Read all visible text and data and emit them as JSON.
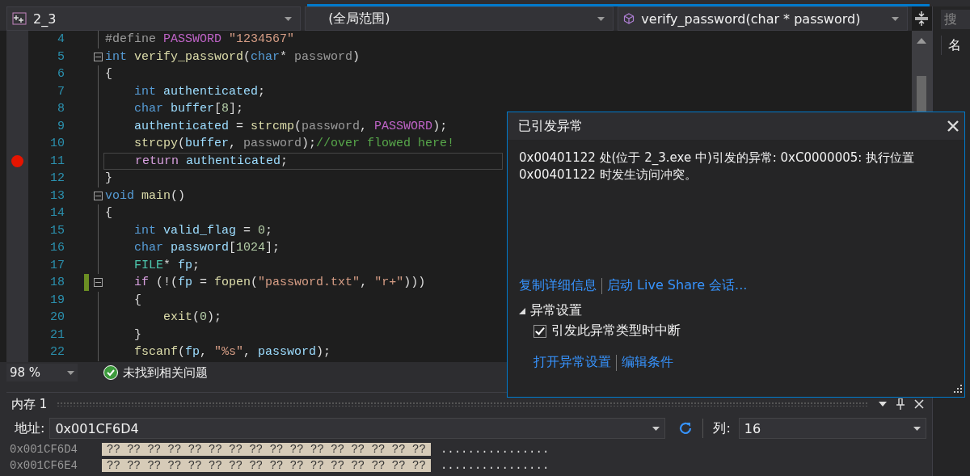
{
  "nav_bar": {
    "project": "2_3",
    "scope": "(全局范围)",
    "member": "verify_password(char * password)"
  },
  "editor": {
    "lines": [
      {
        "number": "4",
        "breakpoint": false,
        "fold": false,
        "changed": false,
        "current": false,
        "tokens": [
          {
            "kind": "preproc",
            "text": "#define "
          },
          {
            "kind": "macro",
            "text": "PASSWORD "
          },
          {
            "kind": "string",
            "text": "\"1234567\""
          }
        ]
      },
      {
        "number": "5",
        "breakpoint": false,
        "fold": true,
        "changed": false,
        "current": false,
        "tokens": [
          {
            "kind": "keyword",
            "text": "int "
          },
          {
            "kind": "func",
            "text": "verify_password"
          },
          {
            "kind": "plain",
            "text": "("
          },
          {
            "kind": "keyword",
            "text": "char"
          },
          {
            "kind": "plain",
            "text": "* "
          },
          {
            "kind": "param",
            "text": "password"
          },
          {
            "kind": "plain",
            "text": ")"
          }
        ]
      },
      {
        "number": "6",
        "breakpoint": false,
        "fold": false,
        "changed": false,
        "current": false,
        "tokens": [
          {
            "kind": "plain",
            "text": "{"
          }
        ]
      },
      {
        "number": "7",
        "breakpoint": false,
        "fold": false,
        "changed": false,
        "current": false,
        "tokens": [
          {
            "kind": "keyword",
            "text": "    int "
          },
          {
            "kind": "var",
            "text": "authenticated"
          },
          {
            "kind": "plain",
            "text": ";"
          }
        ]
      },
      {
        "number": "8",
        "breakpoint": false,
        "fold": false,
        "changed": false,
        "current": false,
        "tokens": [
          {
            "kind": "keyword",
            "text": "    char "
          },
          {
            "kind": "var",
            "text": "buffer"
          },
          {
            "kind": "plain",
            "text": "["
          },
          {
            "kind": "number",
            "text": "8"
          },
          {
            "kind": "plain",
            "text": "];"
          }
        ]
      },
      {
        "number": "9",
        "breakpoint": false,
        "fold": false,
        "changed": false,
        "current": false,
        "tokens": [
          {
            "kind": "var",
            "text": "    authenticated"
          },
          {
            "kind": "plain",
            "text": " = "
          },
          {
            "kind": "func",
            "text": "strcmp"
          },
          {
            "kind": "plain",
            "text": "("
          },
          {
            "kind": "param",
            "text": "password"
          },
          {
            "kind": "plain",
            "text": ", "
          },
          {
            "kind": "macro",
            "text": "PASSWORD"
          },
          {
            "kind": "plain",
            "text": ");"
          }
        ]
      },
      {
        "number": "10",
        "breakpoint": false,
        "fold": false,
        "changed": false,
        "current": false,
        "tokens": [
          {
            "kind": "func",
            "text": "    strcpy"
          },
          {
            "kind": "plain",
            "text": "("
          },
          {
            "kind": "var",
            "text": "buffer"
          },
          {
            "kind": "plain",
            "text": ", "
          },
          {
            "kind": "param",
            "text": "password"
          },
          {
            "kind": "plain",
            "text": ");"
          },
          {
            "kind": "comment",
            "text": "//over flowed here!"
          }
        ]
      },
      {
        "number": "11",
        "breakpoint": true,
        "fold": false,
        "changed": false,
        "current": true,
        "tokens": [
          {
            "kind": "control",
            "text": "    return "
          },
          {
            "kind": "var",
            "text": "authenticated"
          },
          {
            "kind": "plain",
            "text": ";"
          }
        ]
      },
      {
        "number": "12",
        "breakpoint": false,
        "fold": false,
        "changed": false,
        "current": false,
        "tokens": [
          {
            "kind": "plain",
            "text": "}"
          }
        ]
      },
      {
        "number": "13",
        "breakpoint": false,
        "fold": true,
        "changed": false,
        "current": false,
        "tokens": [
          {
            "kind": "keyword",
            "text": "void "
          },
          {
            "kind": "func",
            "text": "main"
          },
          {
            "kind": "plain",
            "text": "()"
          }
        ]
      },
      {
        "number": "14",
        "breakpoint": false,
        "fold": false,
        "changed": false,
        "current": false,
        "tokens": [
          {
            "kind": "plain",
            "text": "{"
          }
        ]
      },
      {
        "number": "15",
        "breakpoint": false,
        "fold": false,
        "changed": false,
        "current": false,
        "tokens": [
          {
            "kind": "keyword",
            "text": "    int "
          },
          {
            "kind": "var",
            "text": "valid_flag"
          },
          {
            "kind": "plain",
            "text": " = "
          },
          {
            "kind": "number",
            "text": "0"
          },
          {
            "kind": "plain",
            "text": ";"
          }
        ]
      },
      {
        "number": "16",
        "breakpoint": false,
        "fold": false,
        "changed": false,
        "current": false,
        "tokens": [
          {
            "kind": "keyword",
            "text": "    char "
          },
          {
            "kind": "var",
            "text": "password"
          },
          {
            "kind": "plain",
            "text": "["
          },
          {
            "kind": "number",
            "text": "1024"
          },
          {
            "kind": "plain",
            "text": "];"
          }
        ]
      },
      {
        "number": "17",
        "breakpoint": false,
        "fold": false,
        "changed": false,
        "current": false,
        "tokens": [
          {
            "kind": "type",
            "text": "    FILE"
          },
          {
            "kind": "plain",
            "text": "* "
          },
          {
            "kind": "var",
            "text": "fp"
          },
          {
            "kind": "plain",
            "text": ";"
          }
        ]
      },
      {
        "number": "18",
        "breakpoint": false,
        "fold": true,
        "changed": true,
        "current": false,
        "tokens": [
          {
            "kind": "control",
            "text": "    if"
          },
          {
            "kind": "plain",
            "text": " (!("
          },
          {
            "kind": "var",
            "text": "fp"
          },
          {
            "kind": "plain",
            "text": " = "
          },
          {
            "kind": "func",
            "text": "fopen"
          },
          {
            "kind": "plain",
            "text": "("
          },
          {
            "kind": "string",
            "text": "\"password.txt\""
          },
          {
            "kind": "plain",
            "text": ", "
          },
          {
            "kind": "string",
            "text": "\"r+\""
          },
          {
            "kind": "plain",
            "text": ")))"
          }
        ]
      },
      {
        "number": "19",
        "breakpoint": false,
        "fold": false,
        "changed": false,
        "current": false,
        "tokens": [
          {
            "kind": "plain",
            "text": "    {"
          }
        ]
      },
      {
        "number": "20",
        "breakpoint": false,
        "fold": false,
        "changed": false,
        "current": false,
        "tokens": [
          {
            "kind": "func",
            "text": "        exit"
          },
          {
            "kind": "plain",
            "text": "("
          },
          {
            "kind": "number",
            "text": "0"
          },
          {
            "kind": "plain",
            "text": ");"
          }
        ]
      },
      {
        "number": "21",
        "breakpoint": false,
        "fold": false,
        "changed": false,
        "current": false,
        "tokens": [
          {
            "kind": "plain",
            "text": "    }"
          }
        ]
      },
      {
        "number": "22",
        "breakpoint": false,
        "fold": false,
        "changed": false,
        "current": false,
        "tokens": [
          {
            "kind": "func",
            "text": "    fscanf"
          },
          {
            "kind": "plain",
            "text": "("
          },
          {
            "kind": "var",
            "text": "fp"
          },
          {
            "kind": "plain",
            "text": ", "
          },
          {
            "kind": "string",
            "text": "\"%s\""
          },
          {
            "kind": "plain",
            "text": ", "
          },
          {
            "kind": "var",
            "text": "password"
          },
          {
            "kind": "plain",
            "text": ");"
          }
        ]
      }
    ]
  },
  "status": {
    "zoom": "98 %",
    "issues": "未找到相关问题"
  },
  "side_panel": {
    "search_placeholder": "搜",
    "column_1": "名"
  },
  "exception_popup": {
    "title": "已引发异常",
    "message": "0x00401122 处(位于 2_3.exe 中)引发的异常: 0xC0000005: 执行位置 0x00401122 时发生访问冲突。",
    "links": [
      "复制详细信息",
      "启动 Live Share 会话..."
    ],
    "settings_heading": "异常设置",
    "settings_expanded": true,
    "break_option": {
      "label": "引发此异常类型时中断",
      "checked": true
    },
    "settings_links": [
      "打开异常设置",
      "编辑条件"
    ]
  },
  "memory": {
    "title": "内存 1",
    "address_label": "地址:",
    "address": "0x001CF6D4",
    "columns_label": "列:",
    "columns": "16",
    "rows": [
      {
        "address": "0x001CF6D4",
        "bytes": "?? ?? ?? ?? ?? ?? ?? ?? ?? ?? ?? ?? ?? ?? ?? ??",
        "text": "................"
      },
      {
        "address": "0x001CF6E4",
        "bytes": "?? ?? ?? ?? ?? ?? ?? ?? ?? ?? ?? ?? ?? ?? ?? ??",
        "text": "................"
      }
    ]
  }
}
